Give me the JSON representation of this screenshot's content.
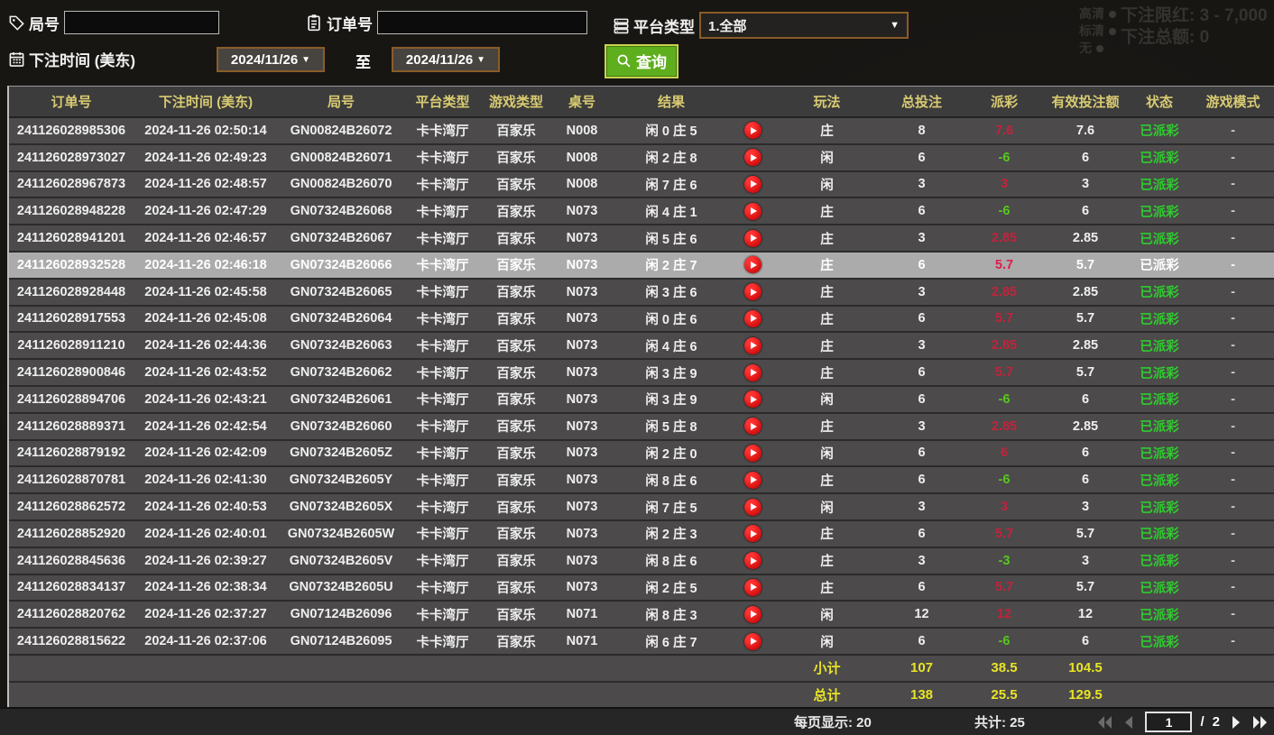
{
  "background": {
    "limit_line": "下注限红: 3 - 7,000",
    "total_line": "下注总额: 0",
    "video_options": [
      "高清",
      "标清",
      "无"
    ]
  },
  "filters": {
    "game_no_label": "局号",
    "game_no_value": "",
    "order_no_label": "订单号",
    "order_no_value": "",
    "platform_label": "平台类型",
    "platform_value": "1.全部",
    "bet_time_label": "下注时间 (美东)",
    "date_from": "2024/11/26",
    "to_label": "至",
    "date_to": "2024/11/26",
    "search_label": "查询"
  },
  "table": {
    "headers": [
      "订单号",
      "下注时间 (美东)",
      "局号",
      "平台类型",
      "游戏类型",
      "桌号",
      "结果",
      "",
      "玩法",
      "总投注",
      "派彩",
      "有效投注额",
      "状态",
      "游戏模式"
    ],
    "rows": [
      {
        "order": "241126028985306",
        "time": "2024-11-26 02:50:14",
        "round": "GN00824B26072",
        "platform": "卡卡湾厅",
        "game_type": "百家乐",
        "table_no": "N008",
        "result": "闲 0 庄 5",
        "play_type": "庄",
        "total_bet": "8",
        "payout": "7.6",
        "payout_neg": false,
        "valid_bet": "7.6",
        "status": "已派彩",
        "game_mode": "-",
        "highlighted": false
      },
      {
        "order": "241126028973027",
        "time": "2024-11-26 02:49:23",
        "round": "GN00824B26071",
        "platform": "卡卡湾厅",
        "game_type": "百家乐",
        "table_no": "N008",
        "result": "闲 2 庄 8",
        "play_type": "闲",
        "total_bet": "6",
        "payout": "-6",
        "payout_neg": true,
        "valid_bet": "6",
        "status": "已派彩",
        "game_mode": "-",
        "highlighted": false
      },
      {
        "order": "241126028967873",
        "time": "2024-11-26 02:48:57",
        "round": "GN00824B26070",
        "platform": "卡卡湾厅",
        "game_type": "百家乐",
        "table_no": "N008",
        "result": "闲 7 庄 6",
        "play_type": "闲",
        "total_bet": "3",
        "payout": "3",
        "payout_neg": false,
        "valid_bet": "3",
        "status": "已派彩",
        "game_mode": "-",
        "highlighted": false
      },
      {
        "order": "241126028948228",
        "time": "2024-11-26 02:47:29",
        "round": "GN07324B26068",
        "platform": "卡卡湾厅",
        "game_type": "百家乐",
        "table_no": "N073",
        "result": "闲 4 庄 1",
        "play_type": "庄",
        "total_bet": "6",
        "payout": "-6",
        "payout_neg": true,
        "valid_bet": "6",
        "status": "已派彩",
        "game_mode": "-",
        "highlighted": false
      },
      {
        "order": "241126028941201",
        "time": "2024-11-26 02:46:57",
        "round": "GN07324B26067",
        "platform": "卡卡湾厅",
        "game_type": "百家乐",
        "table_no": "N073",
        "result": "闲 5 庄 6",
        "play_type": "庄",
        "total_bet": "3",
        "payout": "2.85",
        "payout_neg": false,
        "valid_bet": "2.85",
        "status": "已派彩",
        "game_mode": "-",
        "highlighted": false
      },
      {
        "order": "241126028932528",
        "time": "2024-11-26 02:46:18",
        "round": "GN07324B26066",
        "platform": "卡卡湾厅",
        "game_type": "百家乐",
        "table_no": "N073",
        "result": "闲 2 庄 7",
        "play_type": "庄",
        "total_bet": "6",
        "payout": "5.7",
        "payout_neg": false,
        "valid_bet": "5.7",
        "status": "已派彩",
        "game_mode": "-",
        "highlighted": true
      },
      {
        "order": "241126028928448",
        "time": "2024-11-26 02:45:58",
        "round": "GN07324B26065",
        "platform": "卡卡湾厅",
        "game_type": "百家乐",
        "table_no": "N073",
        "result": "闲 3 庄 6",
        "play_type": "庄",
        "total_bet": "3",
        "payout": "2.85",
        "payout_neg": false,
        "valid_bet": "2.85",
        "status": "已派彩",
        "game_mode": "-",
        "highlighted": false
      },
      {
        "order": "241126028917553",
        "time": "2024-11-26 02:45:08",
        "round": "GN07324B26064",
        "platform": "卡卡湾厅",
        "game_type": "百家乐",
        "table_no": "N073",
        "result": "闲 0 庄 6",
        "play_type": "庄",
        "total_bet": "6",
        "payout": "5.7",
        "payout_neg": false,
        "valid_bet": "5.7",
        "status": "已派彩",
        "game_mode": "-",
        "highlighted": false
      },
      {
        "order": "241126028911210",
        "time": "2024-11-26 02:44:36",
        "round": "GN07324B26063",
        "platform": "卡卡湾厅",
        "game_type": "百家乐",
        "table_no": "N073",
        "result": "闲 4 庄 6",
        "play_type": "庄",
        "total_bet": "3",
        "payout": "2.85",
        "payout_neg": false,
        "valid_bet": "2.85",
        "status": "已派彩",
        "game_mode": "-",
        "highlighted": false
      },
      {
        "order": "241126028900846",
        "time": "2024-11-26 02:43:52",
        "round": "GN07324B26062",
        "platform": "卡卡湾厅",
        "game_type": "百家乐",
        "table_no": "N073",
        "result": "闲 3 庄 9",
        "play_type": "庄",
        "total_bet": "6",
        "payout": "5.7",
        "payout_neg": false,
        "valid_bet": "5.7",
        "status": "已派彩",
        "game_mode": "-",
        "highlighted": false
      },
      {
        "order": "241126028894706",
        "time": "2024-11-26 02:43:21",
        "round": "GN07324B26061",
        "platform": "卡卡湾厅",
        "game_type": "百家乐",
        "table_no": "N073",
        "result": "闲 3 庄 9",
        "play_type": "闲",
        "total_bet": "6",
        "payout": "-6",
        "payout_neg": true,
        "valid_bet": "6",
        "status": "已派彩",
        "game_mode": "-",
        "highlighted": false
      },
      {
        "order": "241126028889371",
        "time": "2024-11-26 02:42:54",
        "round": "GN07324B26060",
        "platform": "卡卡湾厅",
        "game_type": "百家乐",
        "table_no": "N073",
        "result": "闲 5 庄 8",
        "play_type": "庄",
        "total_bet": "3",
        "payout": "2.85",
        "payout_neg": false,
        "valid_bet": "2.85",
        "status": "已派彩",
        "game_mode": "-",
        "highlighted": false
      },
      {
        "order": "241126028879192",
        "time": "2024-11-26 02:42:09",
        "round": "GN07324B2605Z",
        "platform": "卡卡湾厅",
        "game_type": "百家乐",
        "table_no": "N073",
        "result": "闲 2 庄 0",
        "play_type": "闲",
        "total_bet": "6",
        "payout": "6",
        "payout_neg": false,
        "valid_bet": "6",
        "status": "已派彩",
        "game_mode": "-",
        "highlighted": false
      },
      {
        "order": "241126028870781",
        "time": "2024-11-26 02:41:30",
        "round": "GN07324B2605Y",
        "platform": "卡卡湾厅",
        "game_type": "百家乐",
        "table_no": "N073",
        "result": "闲 8 庄 6",
        "play_type": "庄",
        "total_bet": "6",
        "payout": "-6",
        "payout_neg": true,
        "valid_bet": "6",
        "status": "已派彩",
        "game_mode": "-",
        "highlighted": false
      },
      {
        "order": "241126028862572",
        "time": "2024-11-26 02:40:53",
        "round": "GN07324B2605X",
        "platform": "卡卡湾厅",
        "game_type": "百家乐",
        "table_no": "N073",
        "result": "闲 7 庄 5",
        "play_type": "闲",
        "total_bet": "3",
        "payout": "3",
        "payout_neg": false,
        "valid_bet": "3",
        "status": "已派彩",
        "game_mode": "-",
        "highlighted": false
      },
      {
        "order": "241126028852920",
        "time": "2024-11-26 02:40:01",
        "round": "GN07324B2605W",
        "platform": "卡卡湾厅",
        "game_type": "百家乐",
        "table_no": "N073",
        "result": "闲 2 庄 3",
        "play_type": "庄",
        "total_bet": "6",
        "payout": "5.7",
        "payout_neg": false,
        "valid_bet": "5.7",
        "status": "已派彩",
        "game_mode": "-",
        "highlighted": false
      },
      {
        "order": "241126028845636",
        "time": "2024-11-26 02:39:27",
        "round": "GN07324B2605V",
        "platform": "卡卡湾厅",
        "game_type": "百家乐",
        "table_no": "N073",
        "result": "闲 8 庄 6",
        "play_type": "庄",
        "total_bet": "3",
        "payout": "-3",
        "payout_neg": true,
        "valid_bet": "3",
        "status": "已派彩",
        "game_mode": "-",
        "highlighted": false
      },
      {
        "order": "241126028834137",
        "time": "2024-11-26 02:38:34",
        "round": "GN07324B2605U",
        "platform": "卡卡湾厅",
        "game_type": "百家乐",
        "table_no": "N073",
        "result": "闲 2 庄 5",
        "play_type": "庄",
        "total_bet": "6",
        "payout": "5.7",
        "payout_neg": false,
        "valid_bet": "5.7",
        "status": "已派彩",
        "game_mode": "-",
        "highlighted": false
      },
      {
        "order": "241126028820762",
        "time": "2024-11-26 02:37:27",
        "round": "GN07124B26096",
        "platform": "卡卡湾厅",
        "game_type": "百家乐",
        "table_no": "N071",
        "result": "闲 8 庄 3",
        "play_type": "闲",
        "total_bet": "12",
        "payout": "12",
        "payout_neg": false,
        "valid_bet": "12",
        "status": "已派彩",
        "game_mode": "-",
        "highlighted": false
      },
      {
        "order": "241126028815622",
        "time": "2024-11-26 02:37:06",
        "round": "GN07124B26095",
        "platform": "卡卡湾厅",
        "game_type": "百家乐",
        "table_no": "N071",
        "result": "闲 6 庄 7",
        "play_type": "闲",
        "total_bet": "6",
        "payout": "-6",
        "payout_neg": true,
        "valid_bet": "6",
        "status": "已派彩",
        "game_mode": "-",
        "highlighted": false
      }
    ],
    "subtotal": {
      "label": "小计",
      "total_bet": "107",
      "payout": "38.5",
      "valid_bet": "104.5"
    },
    "total": {
      "label": "总计",
      "total_bet": "138",
      "payout": "25.5",
      "valid_bet": "129.5"
    }
  },
  "pagination": {
    "per_page_label": "每页显示: 20",
    "total_count_label": "共计: 25",
    "current_page": "1",
    "separator": "/",
    "total_pages": "2"
  },
  "colors": {
    "header_text": "#d9cb72",
    "row_bg": "#4c4a4a",
    "highlight_row_bg": "#ababab",
    "payout_positive": "#c2233c",
    "payout_negative": "#55c81e",
    "status_paid": "#2ecc2e",
    "totals_yellow": "#e8e427",
    "search_button_green": "#5fae1e",
    "dropdown_border_brown": "#8a5c28"
  }
}
